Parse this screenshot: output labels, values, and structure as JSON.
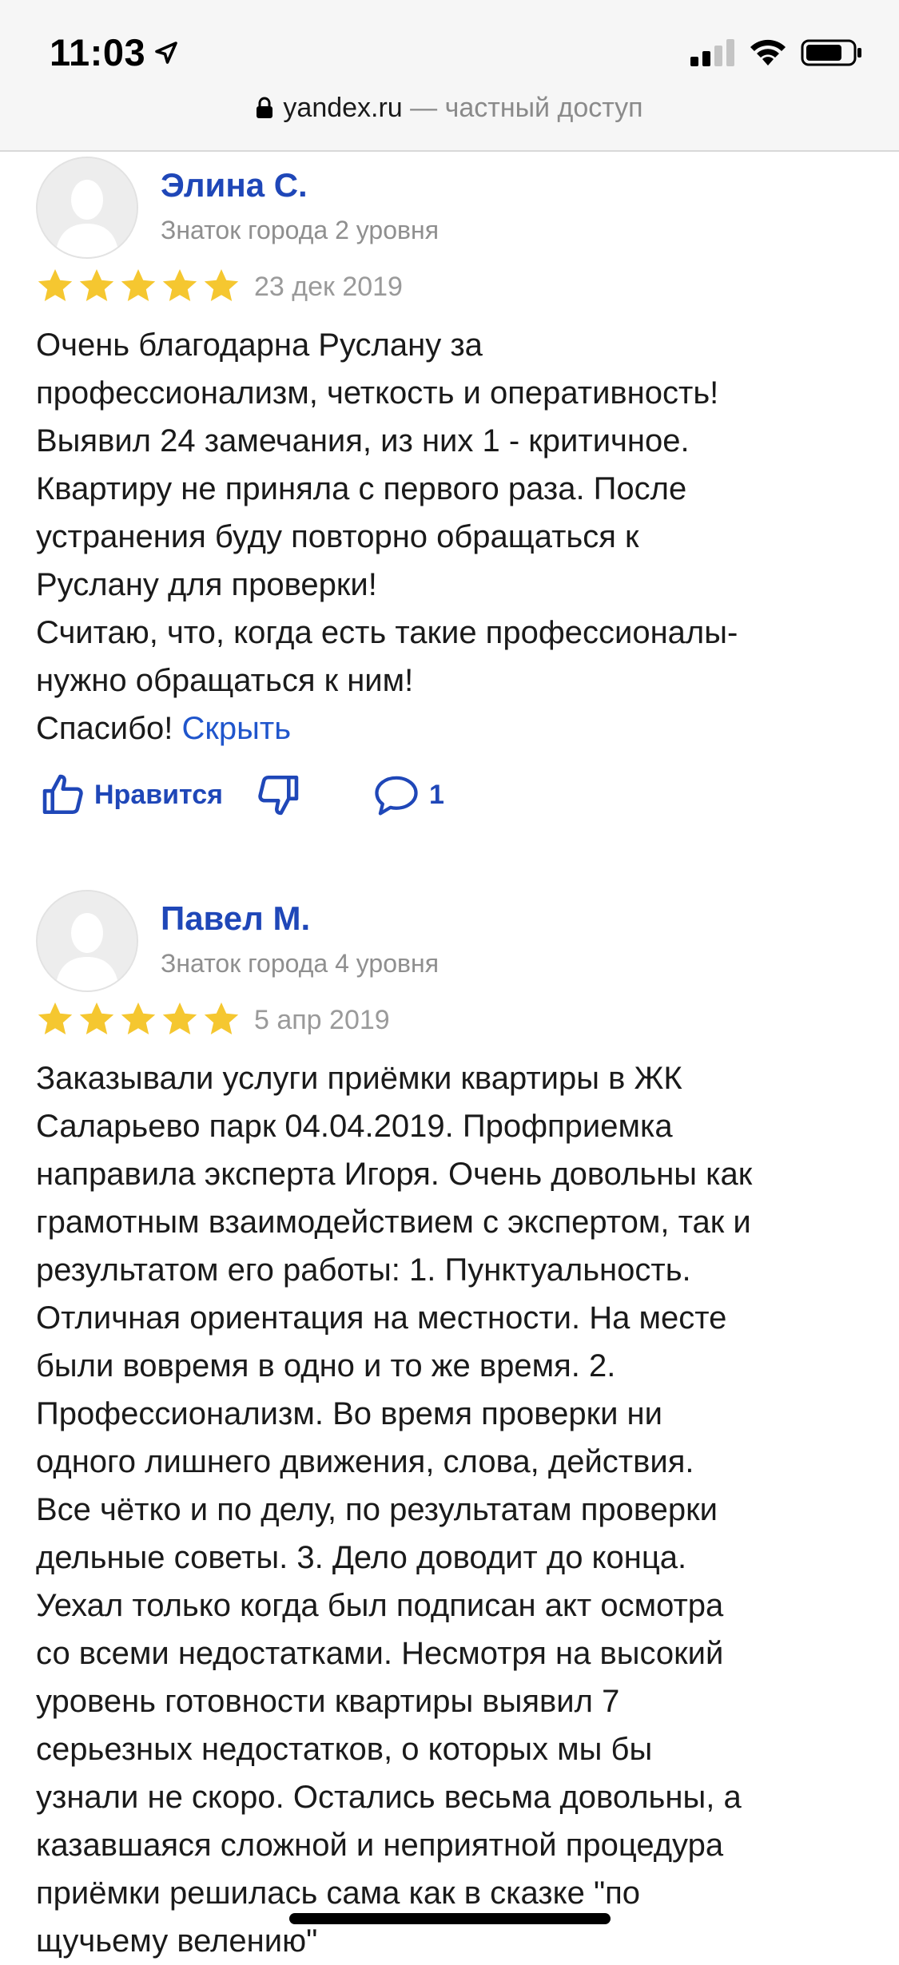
{
  "status_bar": {
    "time": "11:03"
  },
  "browser": {
    "domain": "yandex.ru",
    "suffix": " — частный доступ"
  },
  "reviews": [
    {
      "author": "Элина С.",
      "level": "Знаток города 2 уровня",
      "rating": 5,
      "date": "23 дек 2019",
      "text": "Очень благодарна Руслану за\nпрофессионализм, четкость и оперативность!\nВыявил 24 замечания, из них 1 - критичное.\nКвартиру не приняла с первого раза. После\nустранения буду повторно обращаться к\nРуслану для проверки!\nСчитаю, что, когда есть такие профессионалы-\nнужно обращаться к ним!\nСпасибо! ",
      "hide_label": "Скрыть",
      "like_label": "Нравится",
      "comments_count": "1"
    },
    {
      "author": "Павел М.",
      "level": "Знаток города 4 уровня",
      "rating": 5,
      "date": "5 апр 2019",
      "text": "Заказывали услуги приёмки квартиры в ЖК\nСаларьево парк 04.04.2019. Профприемка\nнаправила эксперта Игоря. Очень довольны как\nграмотным взаимодействием с экспертом, так и\nрезультатом его работы: 1. Пунктуальность.\nОтличная ориентация на местности. На месте\nбыли вовремя в одно и то же время. 2.\nПрофессионализм. Во время проверки ни\nодного лишнего движения, слова, действия.\nВсе чётко и по делу, по результатам проверки\nдельные советы. 3. Дело доводит до конца.\nУехал только когда был подписан акт осмотра\nсо всеми недостатками. Несмотря на высокий\nуровень готовности квартиры выявил 7\nсерьезных недостатков, о которых мы бы\nузнали не скоро. Остались весьма довольны, а\nказавшаяся сложной и неприятной процедура\nприёмки решилась сама как в сказке \"по\nщучьему велению\""
    }
  ],
  "colors": {
    "link": "#1f47b8",
    "star": "#f5c730",
    "muted": "#8f8f8f"
  },
  "icons": {
    "location": "location-arrow-icon",
    "signal": "cellular-signal-icon",
    "wifi": "wifi-icon",
    "battery": "battery-icon",
    "lock": "lock-icon",
    "avatar": "avatar-placeholder-icon",
    "star": "star-icon",
    "like": "thumbs-up-icon",
    "dislike": "thumbs-down-icon",
    "comment": "comment-bubble-icon"
  }
}
